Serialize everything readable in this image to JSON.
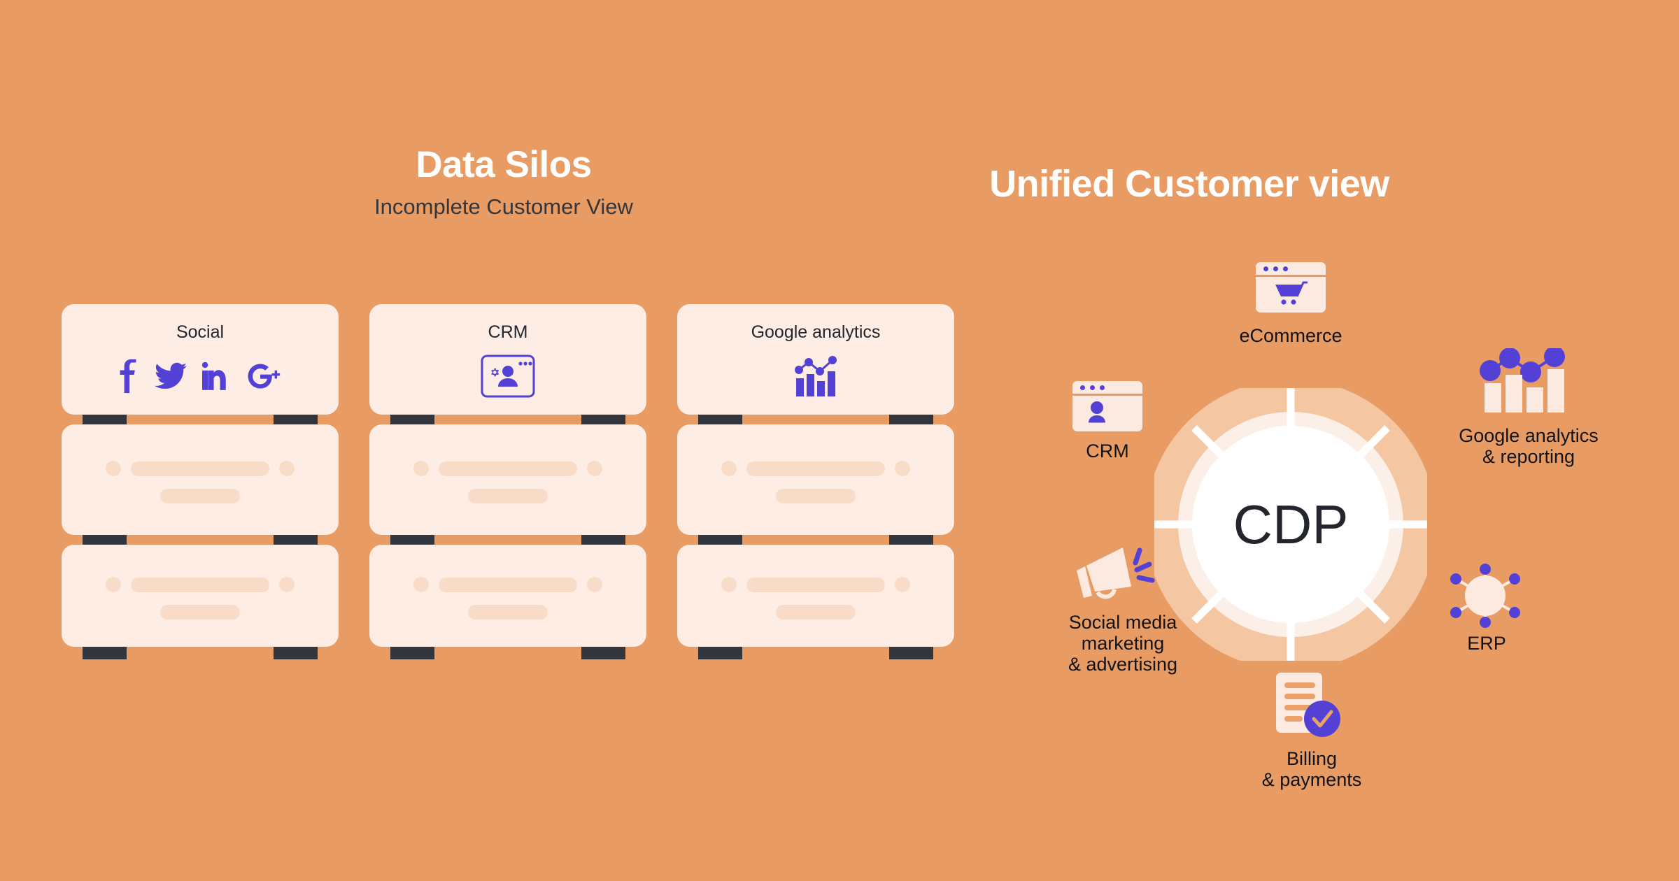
{
  "background_color": "#E89C64",
  "accent_purple": "#5341D6",
  "card_cream": "#FDEDE4",
  "placeholder_peach": "#F9DCC7",
  "leg_dark": "#32353C",
  "left": {
    "title": "Data Silos",
    "subtitle": "Incomplete Customer View",
    "columns": [
      {
        "label": "Social",
        "icons": [
          "facebook-icon",
          "twitter-icon",
          "linkedin-icon",
          "google-plus-icon"
        ]
      },
      {
        "label": "CRM",
        "icons": [
          "crm-browser-user-gear-icon"
        ]
      },
      {
        "label": "Google analytics",
        "icons": [
          "analytics-bar-line-chart-icon"
        ]
      }
    ],
    "stack_rows": 3,
    "placeholder_rows_per_box": 2
  },
  "right": {
    "title": "Unified Customer view",
    "hub": {
      "label": "CDP",
      "spokes": 8,
      "ring_color": "#F4C6A2",
      "halo_color": "#FCEFE7",
      "core_color": "#FFFFFF"
    },
    "nodes": [
      {
        "id": "ecommerce",
        "label": "eCommerce",
        "icon": "shopping-cart-browser-icon"
      },
      {
        "id": "analytics",
        "label": "Google analytics\n& reporting",
        "icon": "bar-chart-line-icon"
      },
      {
        "id": "erp",
        "label": "ERP",
        "icon": "network-nodes-icon"
      },
      {
        "id": "billing",
        "label": "Billing\n& payments",
        "icon": "invoice-check-icon"
      },
      {
        "id": "social",
        "label": "Social media\nmarketing\n& advertising",
        "icon": "megaphone-icon"
      },
      {
        "id": "crm",
        "label": "CRM",
        "icon": "user-browser-icon"
      }
    ]
  }
}
